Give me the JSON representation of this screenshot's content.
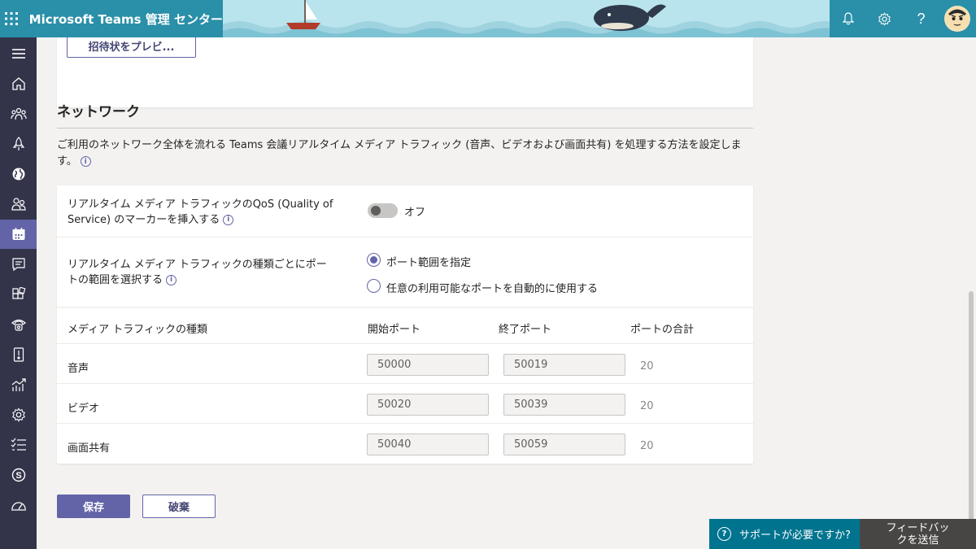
{
  "header": {
    "app_title": "Microsoft Teams 管理 センター",
    "icons": [
      "waffle-icon",
      "bell-icon",
      "gear-icon",
      "help-icon",
      "avatar"
    ]
  },
  "rail": {
    "items": [
      "menu-icon",
      "home-icon",
      "teams-icon",
      "deploy-icon",
      "globe-icon",
      "users-icon",
      "meetings-icon",
      "messaging-icon",
      "apps-icon",
      "voice-icon",
      "locations-icon",
      "analytics-icon",
      "settings-icon",
      "planning-icon",
      "skype-icon",
      "dashboard-icon"
    ],
    "active_index": 6
  },
  "top_card": {
    "preview_button": "招待状をプレビ..."
  },
  "network": {
    "title": "ネットワーク",
    "description": "ご利用のネットワーク全体を流れる Teams 会議リアルタイム メディア トラフィック (音声、ビデオおよび画面共有) を処理する方法を設定しま す。",
    "qos_label": "リアルタイム メディア トラフィックのQoS (Quality of Service) のマーカーを挿入する",
    "qos_state": "オフ",
    "port_range_label": "リアルタイム メディア トラフィックの種類ごとにポートの範囲を選択する",
    "radio_options": [
      "ポート範囲を指定",
      "任意の利用可能なポートを自動的に使用する"
    ],
    "selected_option": 0,
    "table": {
      "headers": [
        "メディア トラフィックの種類",
        "開始ポート",
        "終了ポート",
        "ポートの合計"
      ],
      "rows": [
        {
          "type": "音声",
          "start": "50000",
          "end": "50019",
          "total": "20"
        },
        {
          "type": "ビデオ",
          "start": "50020",
          "end": "50039",
          "total": "20"
        },
        {
          "type": "画面共有",
          "start": "50040",
          "end": "50059",
          "total": "20"
        }
      ]
    }
  },
  "actions": {
    "save": "保存",
    "discard": "破棄"
  },
  "footer": {
    "support": "サポートが必要ですか?",
    "feedback": "フィードバックを送信"
  },
  "colors": {
    "accent": "#6264a7",
    "rail": "#33344a",
    "header": "#2a8fa8",
    "support": "#00748f"
  }
}
